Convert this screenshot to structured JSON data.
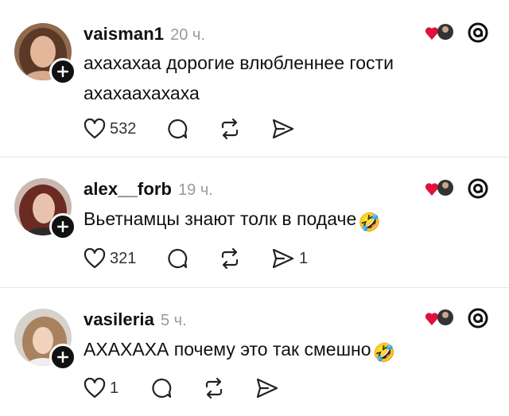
{
  "posts": [
    {
      "username": "vaisman1",
      "time": "20 ч.",
      "text_lines": [
        "ахахахаа дорогие влюбленнее гости",
        "ахахаахахаха"
      ],
      "emoji": "",
      "likes": "532",
      "reposts": ""
    },
    {
      "username": "alex__forb",
      "time": "19 ч.",
      "text_lines": [
        "Вьетнамцы знают толк в подаче"
      ],
      "emoji": "🤣",
      "likes": "321",
      "reposts": "1"
    },
    {
      "username": "vasileria",
      "time": "5 ч.",
      "text_lines": [
        "АХАХАХА почему это так смешно"
      ],
      "emoji": "🤣",
      "likes": "1",
      "reposts": ""
    }
  ],
  "icons": {
    "like": "heart-icon",
    "comment": "comment-icon",
    "repost": "repost-icon",
    "share": "share-icon",
    "follow": "plus-icon",
    "app": "threads-logo-icon",
    "liked_by_author": "heart-avatar-badge"
  },
  "colors": {
    "heart_red": "#e0113b",
    "text": "#111111",
    "muted": "#9a9a9a"
  }
}
